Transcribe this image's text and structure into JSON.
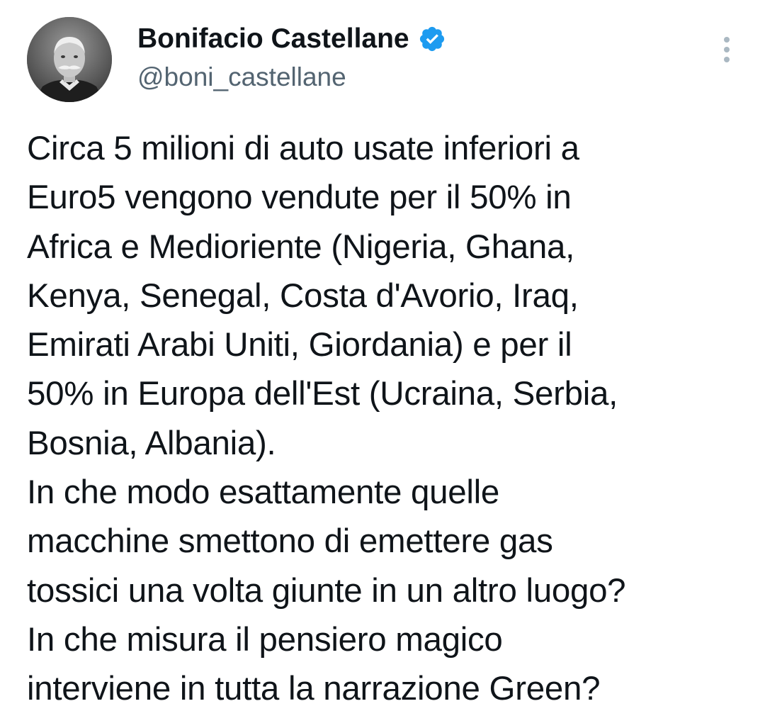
{
  "author": {
    "display_name": "Bonifacio Castellane",
    "handle": "@boni_castellane",
    "verified": true,
    "verified_color": "#1d9bf0",
    "avatar_icon": "vintage-portrait-avatar"
  },
  "menu": {
    "icon": "more-vertical-icon"
  },
  "tweet": {
    "text": "Circa 5 milioni di auto usate inferiori a\nEuro5 vengono vendute per il 50% in\nAfrica e Medioriente (Nigeria, Ghana,\nKenya, Senegal, Costa d'Avorio, Iraq,\nEmirati Arabi Uniti, Giordania) e per il\n50% in Europa dell'Est (Ucraina, Serbia,\nBosnia, Albania).\nIn che modo esattamente quelle\nmacchine smettono di emettere gas\ntossici una volta giunte in un altro luogo?\nIn che misura il pensiero magico\ninterviene in tutta la narrazione Green?"
  }
}
